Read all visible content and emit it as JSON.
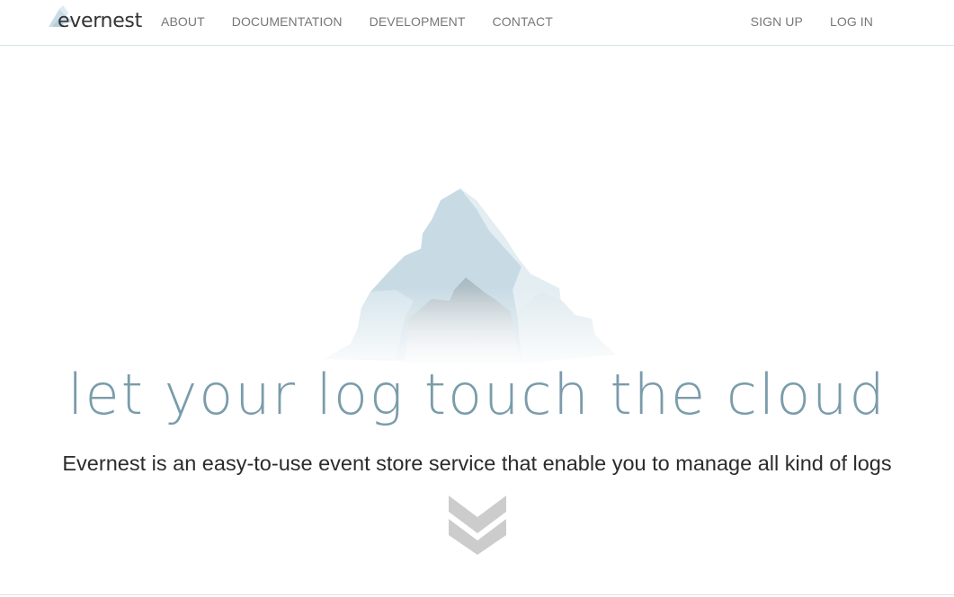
{
  "brand": {
    "name": "evernest",
    "icon": "mountain-logo-icon"
  },
  "nav": {
    "left": [
      {
        "label": "ABOUT"
      },
      {
        "label": "DOCUMENTATION"
      },
      {
        "label": "DEVELOPMENT"
      },
      {
        "label": "CONTACT"
      }
    ],
    "right": [
      {
        "label": "SIGN UP"
      },
      {
        "label": "LOG IN"
      }
    ]
  },
  "hero": {
    "image": "mountain-illustration",
    "title": "let your log touch the cloud",
    "subtitle": "Evernest is an easy-to-use event store service that enable you to manage all kind of logs",
    "scroll_icon": "double-chevron-down-icon"
  },
  "colors": {
    "title": "#7a9cab",
    "nav_text": "#777777",
    "mountain_light": "#e6eef3",
    "mountain_mid": "#c7dbe5",
    "mountain_dark": "#aebdc4",
    "chevron": "#cccccc"
  }
}
